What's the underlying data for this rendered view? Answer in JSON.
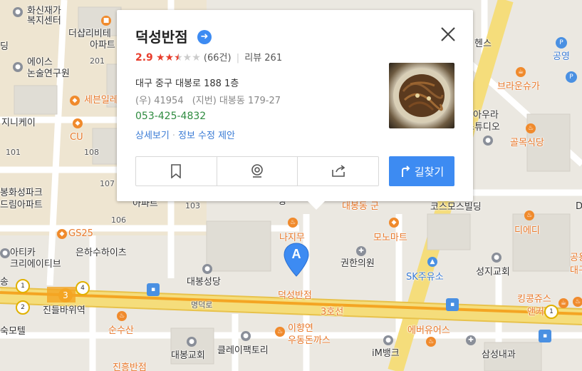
{
  "place": {
    "name": "덕성반점",
    "rating": "2.9",
    "rating_stars": 2.5,
    "review_count": "(66건)",
    "reviews_label": "리뷰 261",
    "address": "대구 중구 대봉로 188 1층",
    "zip": "(우) 41954",
    "lot_address": "(지번) 대봉동 179-27",
    "phone": "053-425-4832",
    "detail_link": "상세보기",
    "edit_link": "정보 수정 제안",
    "route_button": "길찾기",
    "action_icons": [
      "bookmark-icon",
      "roadview-icon",
      "share-icon"
    ]
  },
  "marker": {
    "letter": "A",
    "label": "덕성반점"
  },
  "map_labels": [
    {
      "text": "화신재가",
      "cls": ""
    },
    {
      "text": "복지센터",
      "cls": ""
    },
    {
      "text": "더샵리비테",
      "cls": ""
    },
    {
      "text": "아파트",
      "cls": ""
    },
    {
      "text": "201",
      "cls": "small"
    },
    {
      "text": "에이스",
      "cls": ""
    },
    {
      "text": "논술연구원",
      "cls": ""
    },
    {
      "text": "세븐일레",
      "cls": "orange"
    },
    {
      "text": "지니케이",
      "cls": ""
    },
    {
      "text": "CU",
      "cls": "orange"
    },
    {
      "text": "101",
      "cls": "small"
    },
    {
      "text": "108",
      "cls": "small"
    },
    {
      "text": "107",
      "cls": "small"
    },
    {
      "text": "봉화성파크",
      "cls": ""
    },
    {
      "text": "드림아파트",
      "cls": ""
    },
    {
      "text": "아파트",
      "cls": ""
    },
    {
      "text": "103",
      "cls": "small"
    },
    {
      "text": "106",
      "cls": "small"
    },
    {
      "text": "GS25",
      "cls": "orange"
    },
    {
      "text": "아티카",
      "cls": ""
    },
    {
      "text": "크리에이티브",
      "cls": ""
    },
    {
      "text": "은하수하이츠",
      "cls": ""
    },
    {
      "text": "대봉성당",
      "cls": ""
    },
    {
      "text": "명덕로",
      "cls": "small"
    },
    {
      "text": "진들바위역",
      "cls": ""
    },
    {
      "text": "숙모텔",
      "cls": ""
    },
    {
      "text": "순수산",
      "cls": "orange"
    },
    {
      "text": "대봉교회",
      "cls": ""
    },
    {
      "text": "클레이팩토리",
      "cls": ""
    },
    {
      "text": "진흥반점",
      "cls": "orange"
    },
    {
      "text": "나지무",
      "cls": "orange"
    },
    {
      "text": "모노마트",
      "cls": "orange"
    },
    {
      "text": "권한의원",
      "cls": ""
    },
    {
      "text": "SK주유소",
      "cls": "blue"
    },
    {
      "text": "성지교회",
      "cls": ""
    },
    {
      "text": "3호선",
      "cls": "orange"
    },
    {
      "text": "이향연",
      "cls": "orange"
    },
    {
      "text": "우동돈까스",
      "cls": "orange"
    },
    {
      "text": "에버유어스",
      "cls": "orange"
    },
    {
      "text": "iM뱅크",
      "cls": ""
    },
    {
      "text": "삼성내과",
      "cls": ""
    },
    {
      "text": "킹콩쥬스",
      "cls": "orange"
    },
    {
      "text": "앤커",
      "cls": "orange"
    },
    {
      "text": "디에디",
      "cls": "orange"
    },
    {
      "text": "코스모스빌딩",
      "cls": ""
    },
    {
      "text": "골목식당",
      "cls": "orange"
    },
    {
      "text": "브라운슈가",
      "cls": "orange"
    },
    {
      "text": "공영",
      "cls": "blue"
    },
    {
      "text": "헨스",
      "cls": ""
    },
    {
      "text": "아우라",
      "cls": ""
    },
    {
      "text": "스튜디오",
      "cls": ""
    },
    {
      "text": "공용",
      "cls": "orange"
    },
    {
      "text": "대구",
      "cls": "orange"
    },
    {
      "text": "대봉동 군",
      "cls": "orange"
    },
    {
      "text": "평",
      "cls": ""
    },
    {
      "text": "딩",
      "cls": ""
    },
    {
      "text": "송",
      "cls": ""
    },
    {
      "text": "D",
      "cls": ""
    }
  ],
  "station_numbers": [
    "1",
    "2",
    "3",
    "4"
  ]
}
